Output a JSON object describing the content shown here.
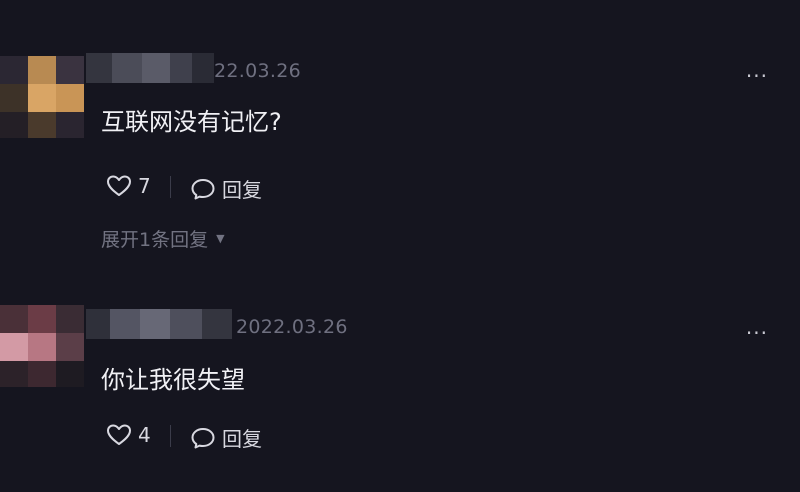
{
  "comments": [
    {
      "date": "22.03.26",
      "text": "互联网没有记忆?",
      "likes": "7",
      "reply_label": "回复",
      "more": "···",
      "expand_label": "展开1条回复"
    },
    {
      "date": "2022.03.26",
      "text": "你让我很失望",
      "likes": "4",
      "reply_label": "回复",
      "more": "···"
    }
  ],
  "colors": {
    "background": "#15151f",
    "muted_text": "#6f7080",
    "primary_text": "#f1f1f5"
  },
  "icons": [
    "heart-icon",
    "comment-bubble-icon",
    "more-dots-icon",
    "caret-down-icon"
  ]
}
